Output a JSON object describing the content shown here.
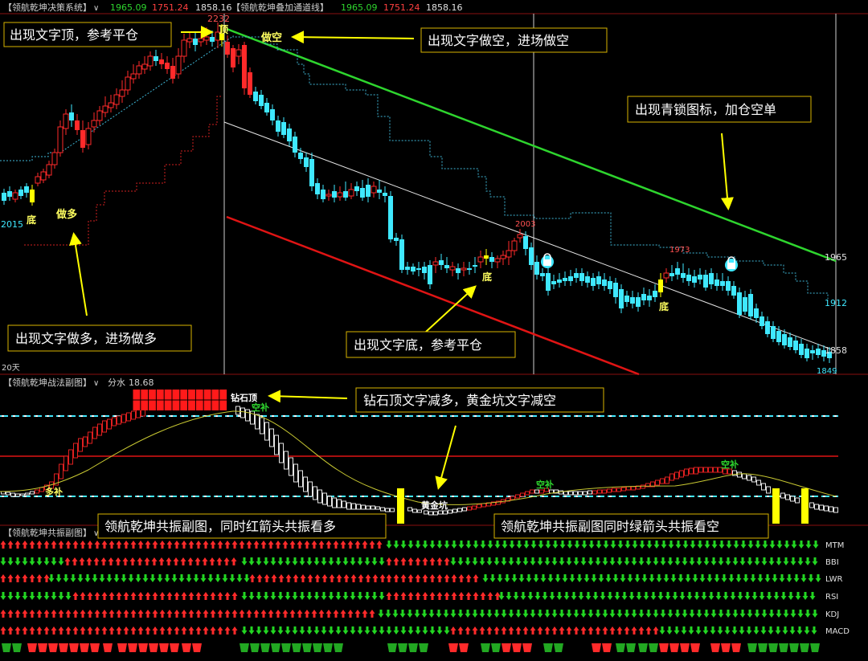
{
  "colors": {
    "up": "#ff2a2a",
    "down": "#3fe8ff",
    "green_line": "#2ed52e",
    "red_line": "#e01414",
    "annotation_border": "#d8b400",
    "annotation_text": "#ffffff",
    "yellow": "#ffff00",
    "frame": "#8a0f0f"
  },
  "main_panel": {
    "header": {
      "title": "【领航乾坤决策系统】",
      "val1": "1965.09",
      "val2": "1751.24",
      "val3": "1858.16",
      "title2": "【领航乾坤叠加通道线】",
      "val4": "1965.09",
      "val5": "1751.24",
      "val6": "1858.16"
    },
    "price_labels": {
      "high": "2232",
      "p2003": "2003",
      "p1973": "1973",
      "p2015": "2015",
      "r1965": "1965",
      "r1912": "1912",
      "r1858": "1858",
      "r1849": "1849"
    },
    "chart_texts": {
      "ding": "顶",
      "zuokong": "做空",
      "zuoduo": "做多",
      "di1": "底",
      "di2": "底",
      "di3": "底"
    },
    "period": "20天",
    "annotations": {
      "a1": "出现文字顶，参考平仓",
      "a2": "出现文字做空，进场做空",
      "a3": "出现青锁图标，加仓空单",
      "a4": "出现文字做多，进场做多",
      "a5": "出现文字底，参考平仓"
    }
  },
  "sub_panel1": {
    "title": "【领航乾坤战法副图】",
    "label": "分水",
    "value": "18.68",
    "texts": {
      "zuanshiding": "钻石顶",
      "kongbu1": "空补",
      "duobu": "多补",
      "kongbu2": "空补",
      "kongbu3": "空补",
      "huangjinkeng": "黄金坑"
    },
    "annotation": "钻石顶文字减多，黄金坑文字减空"
  },
  "sub_panel2": {
    "title": "【领航乾坤共振副图】",
    "annotation_left": "领航乾坤共振副图，同时红箭头共振看多",
    "annotation_right": "领航乾坤共振副图同时绿箭头共振看空",
    "rows": [
      "MTM",
      "BBI",
      "LWR",
      "RSI",
      "KDJ",
      "MACD"
    ]
  }
}
